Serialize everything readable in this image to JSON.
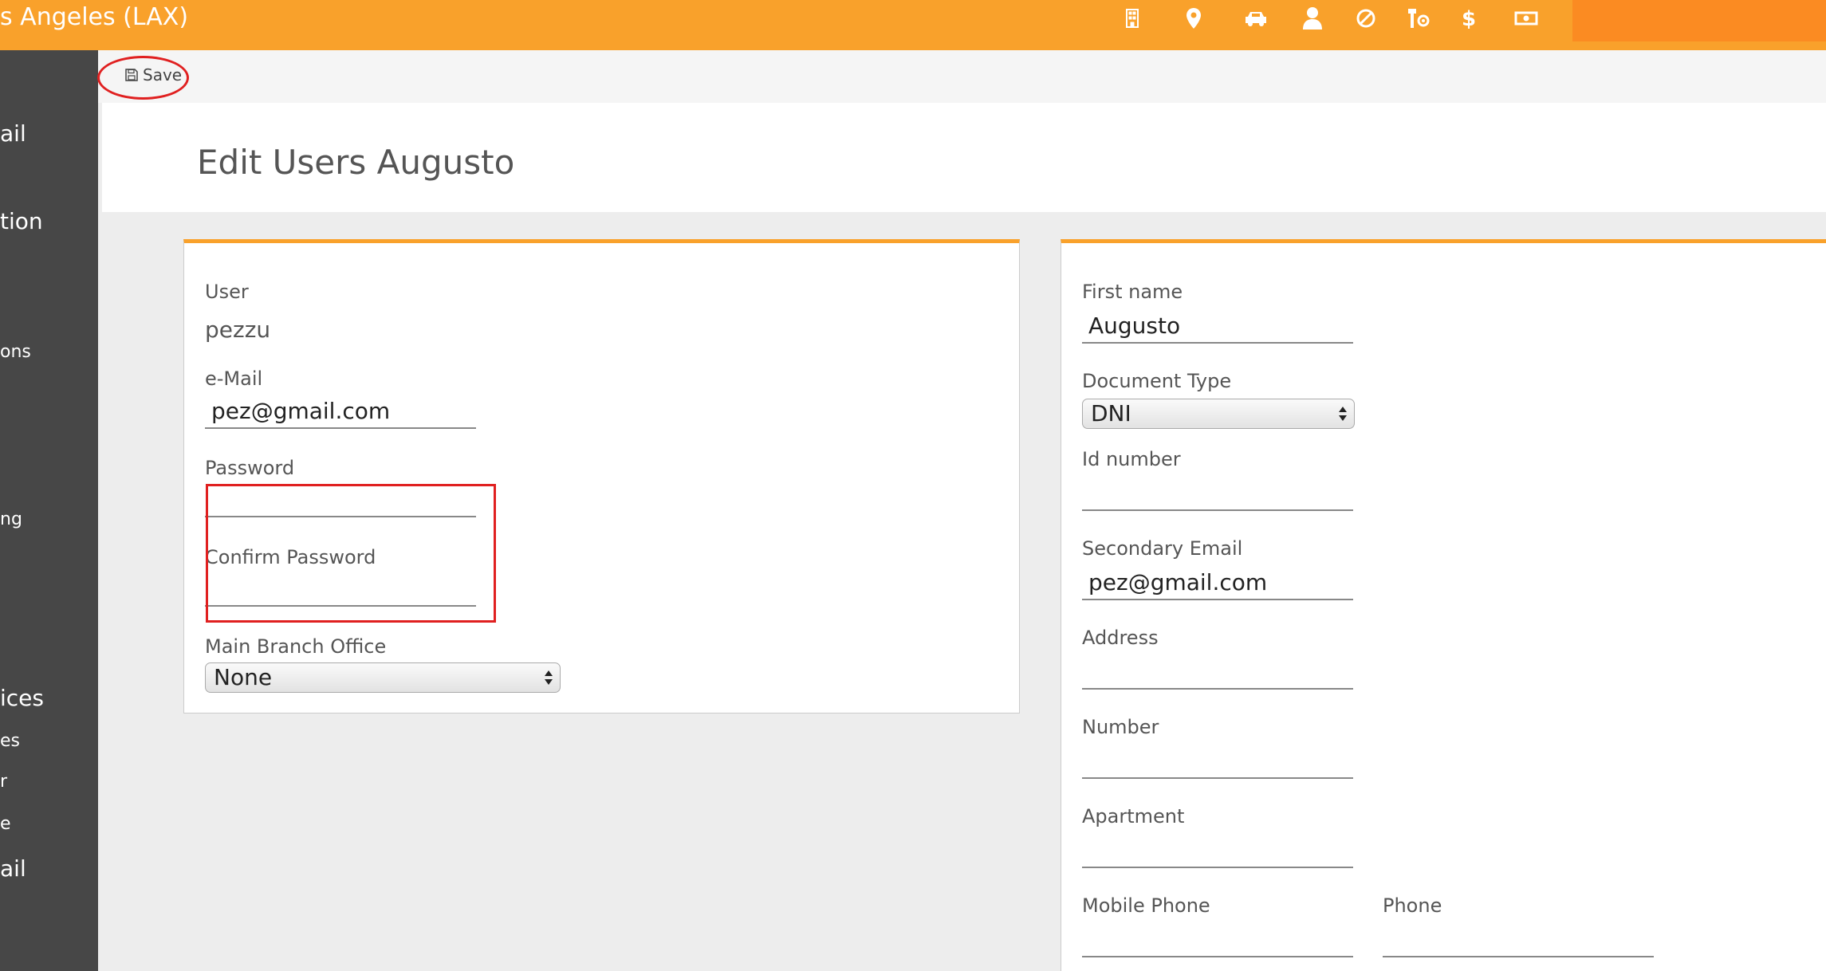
{
  "header": {
    "location_title": "s Angeles (LAX)",
    "nav_icons": [
      "building-icon",
      "map-pin-icon",
      "car-icon",
      "user-icon",
      "ban-icon",
      "tools-icon",
      "dollar-icon",
      "cash-icon"
    ]
  },
  "sidebar": {
    "items": [
      "ail",
      "tion",
      "ons",
      "ng",
      "ices",
      "es",
      "r",
      "e",
      "ail"
    ]
  },
  "toolbar": {
    "save_label": "Save"
  },
  "page": {
    "title": "Edit Users Augusto"
  },
  "left_panel": {
    "user_label": "User",
    "user_value": "pezzu",
    "email_label": "e-Mail",
    "email_value": "pez@gmail.com",
    "password_label": "Password",
    "password_value": "",
    "confirm_password_label": "Confirm Password",
    "confirm_password_value": "",
    "branch_label": "Main Branch Office",
    "branch_value": "None"
  },
  "right_panel": {
    "first_name_label": "First name",
    "first_name_value": "Augusto",
    "doc_type_label": "Document Type",
    "doc_type_value": "DNI",
    "id_number_label": "Id number",
    "id_number_value": "",
    "secondary_email_label": "Secondary Email",
    "secondary_email_value": "pez@gmail.com",
    "address_label": "Address",
    "address_value": "",
    "number_label": "Number",
    "number_value": "",
    "apartment_label": "Apartment",
    "apartment_value": "",
    "mobile_phone_label": "Mobile Phone",
    "mobile_phone_value": "",
    "phone_label": "Phone",
    "phone_value": ""
  },
  "colors": {
    "accent": "#f9a12b",
    "accent_dark": "#fb8b22",
    "sidebar_bg": "#474747",
    "highlight": "#e02020"
  }
}
